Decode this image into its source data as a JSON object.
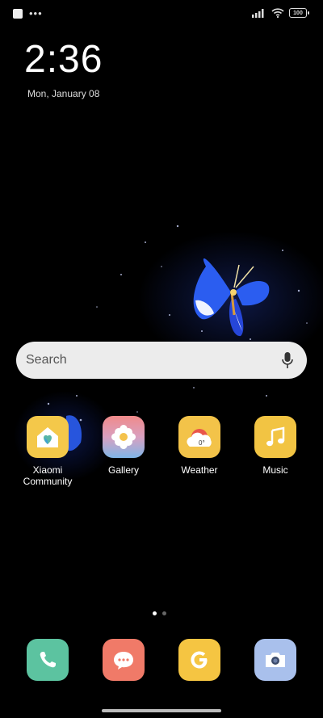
{
  "status_bar": {
    "battery": "100"
  },
  "lockscreen": {
    "time": "2:36",
    "date": "Mon, January 08"
  },
  "search": {
    "placeholder": "Search"
  },
  "apps": [
    {
      "label": "Xiaomi Community"
    },
    {
      "label": "Gallery"
    },
    {
      "label": "Weather"
    },
    {
      "label": "Music"
    }
  ],
  "weather_widget": {
    "temp": "0°"
  },
  "dock": [
    "Phone",
    "Messages",
    "Google",
    "Camera"
  ],
  "colors": {
    "community": "#f4c84a",
    "gallery_top": "#f08a8a",
    "gallery_bottom": "#7fb6e8",
    "weather": "#f3c349",
    "music": "#f2c443",
    "phone": "#5cc3a0",
    "messages": "#f07a68",
    "google": "#f5c542",
    "camera": "#a9c0ec"
  }
}
